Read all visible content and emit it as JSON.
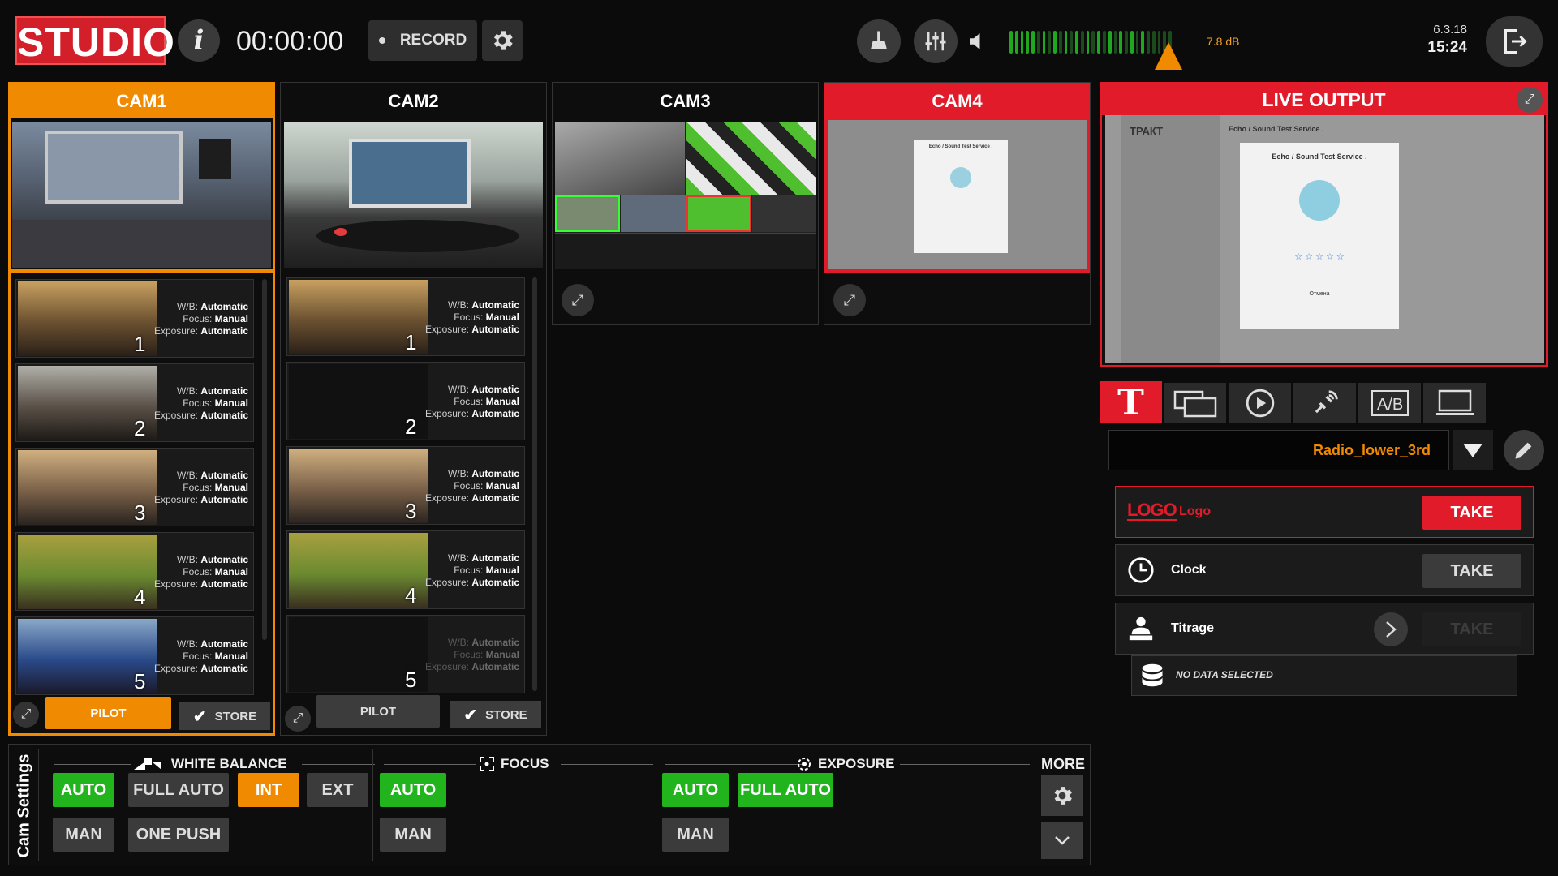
{
  "app": {
    "logo": "STUDIO",
    "timer": "00:00:00",
    "record_label": "RECORD",
    "level_db": "7.8 dB",
    "date": "6.3.18",
    "time": "15:24"
  },
  "meter": {
    "level": 0.87,
    "colors": {
      "green": "#1ea81e",
      "dim": "#1c4a1c",
      "orange": "#c88a22"
    }
  },
  "cameras": [
    {
      "label": "CAM1",
      "state": "preview-selected",
      "color": "#f08a00",
      "presets": [
        {
          "number": "1",
          "wb_label": "W/B:",
          "wb": "Automatic",
          "focus_label": "Focus:",
          "focus": "Manual",
          "exposure_label": "Exposure:",
          "exposure": "Automatic"
        },
        {
          "number": "2",
          "wb_label": "W/B:",
          "wb": "Automatic",
          "focus_label": "Focus:",
          "focus": "Manual",
          "exposure_label": "Exposure:",
          "exposure": "Automatic"
        },
        {
          "number": "3",
          "wb_label": "W/B:",
          "wb": "Automatic",
          "focus_label": "Focus:",
          "focus": "Manual",
          "exposure_label": "Exposure:",
          "exposure": "Automatic"
        },
        {
          "number": "4",
          "wb_label": "W/B:",
          "wb": "Automatic",
          "focus_label": "Focus:",
          "focus": "Manual",
          "exposure_label": "Exposure:",
          "exposure": "Automatic"
        },
        {
          "number": "5",
          "wb_label": "W/B:",
          "wb": "Automatic",
          "focus_label": "Focus:",
          "focus": "Manual",
          "exposure_label": "Exposure:",
          "exposure": "Automatic"
        }
      ],
      "pilot_label": "PILOT",
      "store_label": "STORE"
    },
    {
      "label": "CAM2",
      "state": "idle",
      "presets": [
        {
          "number": "1",
          "wb_label": "W/B:",
          "wb": "Automatic",
          "focus_label": "Focus:",
          "focus": "Manual",
          "exposure_label": "Exposure:",
          "exposure": "Automatic"
        },
        {
          "number": "2",
          "wb_label": "W/B:",
          "wb": "Automatic",
          "focus_label": "Focus:",
          "focus": "Manual",
          "exposure_label": "Exposure:",
          "exposure": "Automatic"
        },
        {
          "number": "3",
          "wb_label": "W/B:",
          "wb": "Automatic",
          "focus_label": "Focus:",
          "focus": "Manual",
          "exposure_label": "Exposure:",
          "exposure": "Automatic"
        },
        {
          "number": "4",
          "wb_label": "W/B:",
          "wb": "Automatic",
          "focus_label": "Focus:",
          "focus": "Manual",
          "exposure_label": "Exposure:",
          "exposure": "Automatic"
        },
        {
          "number": "5",
          "wb_label": "W/B:",
          "wb": "Automatic",
          "focus_label": "Focus:",
          "focus": "Manual",
          "exposure_label": "Exposure:",
          "exposure": "Automatic"
        }
      ],
      "pilot_label": "PILOT",
      "store_label": "STORE"
    },
    {
      "label": "CAM3",
      "state": "idle"
    },
    {
      "label": "CAM4",
      "state": "on-air",
      "color": "#e21b2a"
    }
  ],
  "live_output": {
    "title": "LIVE OUTPUT",
    "screen_title": "Echo / Sound Test Service .",
    "screen_button": "Отмена",
    "sidebar_brand": "ТРАКТ"
  },
  "cam4_screen": {
    "title": "Echo / Sound Test Service ."
  },
  "graphics": {
    "tabs": [
      "text-tab",
      "layout-tab",
      "play-tab",
      "satellite-tab",
      "ab-tab",
      "display-tab"
    ],
    "selected_template": "Radio_lower_3rd",
    "items": [
      {
        "icon": "LOGO",
        "label": "Logo",
        "take": "TAKE",
        "active": true
      },
      {
        "label": "Clock",
        "take": "TAKE",
        "active": false
      },
      {
        "label": "Titrage",
        "take": "TAKE",
        "active": false,
        "disabled": true
      }
    ],
    "no_data": "NO DATA SELECTED"
  },
  "cam_settings": {
    "title": "Cam Settings",
    "white_balance": {
      "title": "WHITE BALANCE",
      "buttons": [
        "AUTO",
        "FULL AUTO",
        "INT",
        "EXT",
        "MAN",
        "ONE PUSH"
      ]
    },
    "focus": {
      "title": "FOCUS",
      "buttons": [
        "AUTO",
        "MAN"
      ]
    },
    "exposure": {
      "title": "EXPOSURE",
      "buttons": [
        "AUTO",
        "FULL AUTO",
        "MAN"
      ]
    },
    "more": "MORE"
  },
  "colors": {
    "accent": "#f08a00",
    "onair": "#e21b2a",
    "active_green": "#22b41c"
  }
}
